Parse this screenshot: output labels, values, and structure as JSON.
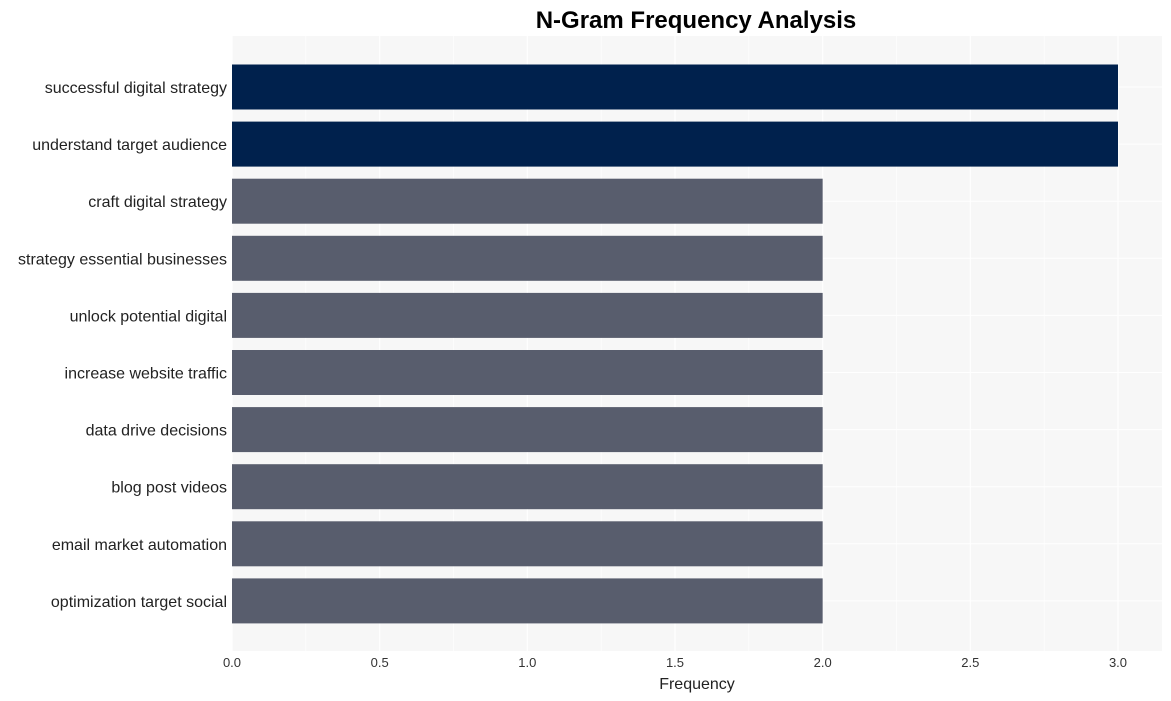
{
  "chart_data": {
    "type": "bar",
    "orientation": "horizontal",
    "title": "N-Gram Frequency Analysis",
    "xlabel": "Frequency",
    "ylabel": "",
    "xlim": [
      0,
      3.15
    ],
    "xticks": [
      "0.0",
      "0.5",
      "1.0",
      "1.5",
      "2.0",
      "2.5",
      "3.0"
    ],
    "grid": true,
    "categories": [
      "successful digital strategy",
      "understand target audience",
      "craft digital strategy",
      "strategy essential businesses",
      "unlock potential digital",
      "increase website traffic",
      "data drive decisions",
      "blog post videos",
      "email market automation",
      "optimization target social"
    ],
    "values": [
      3,
      3,
      2,
      2,
      2,
      2,
      2,
      2,
      2,
      2
    ],
    "colors": {
      "highlight": "#00214d",
      "default": "#585d6d",
      "plot_background": "#f7f7f7",
      "grid": "#ffffff"
    }
  }
}
